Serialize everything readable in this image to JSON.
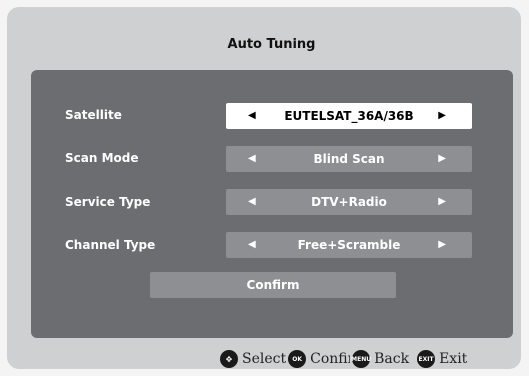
{
  "title": "Auto Tuning",
  "rows": [
    {
      "label": "Satellite",
      "value": "EUTELSAT_36A/36B",
      "active": true
    },
    {
      "label": "Scan Mode",
      "value": "Blind Scan",
      "active": false
    },
    {
      "label": "Service Type",
      "value": "DTV+Radio",
      "active": false
    },
    {
      "label": "Channel Type",
      "value": "Free+Scramble",
      "active": false
    }
  ],
  "arrows": {
    "left": "◀",
    "right": "▶"
  },
  "confirm_label": "Confirm",
  "hints": [
    {
      "icon": "dpad-icon",
      "icon_text": "✥",
      "label": "Select"
    },
    {
      "icon": "ok-icon",
      "icon_text": "OK",
      "label": "Confirm"
    },
    {
      "icon": "menu-icon",
      "icon_text": "MENU",
      "label": "Back"
    },
    {
      "icon": "exit-icon",
      "icon_text": "EXIT",
      "label": "Exit"
    }
  ]
}
